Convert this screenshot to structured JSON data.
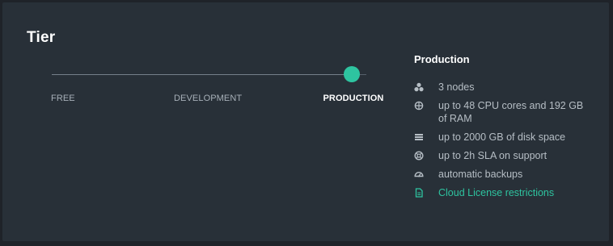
{
  "tier": {
    "title": "Tier",
    "slider": {
      "selected_index": 2,
      "options": [
        "FREE",
        "DEVELOPMENT",
        "PRODUCTION"
      ]
    }
  },
  "details": {
    "title": "Production",
    "features": [
      {
        "icon": "nodes-icon",
        "text": "3 nodes"
      },
      {
        "icon": "cpu-icon",
        "text": "up to 48 CPU cores and 192 GB of RAM"
      },
      {
        "icon": "disk-icon",
        "text": "up to 2000 GB of disk space"
      },
      {
        "icon": "support-icon",
        "text": "up to 2h SLA on support"
      },
      {
        "icon": "backup-icon",
        "text": "automatic backups"
      }
    ],
    "license_link": {
      "icon": "document-icon",
      "text": "Cloud License restrictions"
    }
  },
  "colors": {
    "accent": "#2ec4a0",
    "panel": "#283038",
    "background": "#1f2329"
  }
}
